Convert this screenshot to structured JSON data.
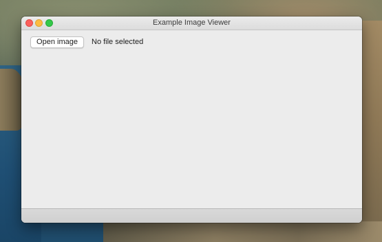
{
  "window": {
    "title": "Example Image Viewer"
  },
  "toolbar": {
    "open_button_label": "Open image",
    "file_status": "No file selected"
  },
  "traffic_lights": {
    "close_color": "#fc605c",
    "minimize_color": "#fdbc40",
    "zoom_color": "#34c84a"
  }
}
